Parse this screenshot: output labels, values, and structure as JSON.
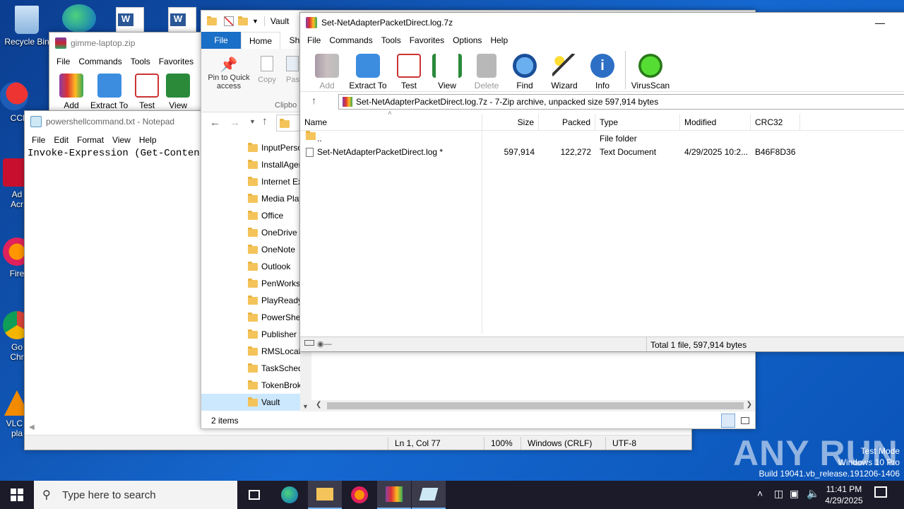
{
  "desktop": {
    "icons": [
      {
        "label": "Recycle Bin"
      },
      {
        "label": "CCle"
      },
      {
        "label": "Ad\nAcr"
      },
      {
        "label": "Fire"
      },
      {
        "label": "Go\nChr"
      },
      {
        "label": "VLC r\npla"
      }
    ],
    "watermark": "ANY RUN",
    "test_mode": {
      "line1": "Test Mode",
      "line2": "Windows 10 Pro",
      "line3": "Build 19041.vb_release.191206-1406"
    }
  },
  "zip_window": {
    "title": "gimme-laptop.zip",
    "menu": [
      "File",
      "Commands",
      "Tools",
      "Favorites"
    ],
    "toolbar": [
      "Add",
      "Extract To",
      "Test",
      "View"
    ]
  },
  "notepad": {
    "title": "powershellcommand.txt - Notepad",
    "menu": [
      "File",
      "Edit",
      "Format",
      "View",
      "Help"
    ],
    "content": "Invoke-Expression (Get-Content",
    "status": {
      "position": "Ln 1, Col 77",
      "zoom": "100%",
      "eol": "Windows (CRLF)",
      "encoding": "UTF-8"
    }
  },
  "explorer": {
    "title": "Vault",
    "tabs": {
      "file": "File",
      "home": "Home",
      "share": "Sh"
    },
    "ribbon": {
      "pin": "Pin to Quick access",
      "copy": "Copy",
      "paste": "Pas",
      "group": "Clipbo"
    },
    "folders": [
      "InputPerso",
      "InstallAger",
      "Internet Ex",
      "Media Play",
      "Office",
      "OneDrive",
      "OneNote",
      "Outlook",
      "PenWorks",
      "PlayReady",
      "PowerShel",
      "Publisher",
      "RMSLocalS",
      "TaskSched",
      "TokenBrok",
      "Vault"
    ],
    "selected_folder": "Vault",
    "item_count": "2 items"
  },
  "sevenzip": {
    "title": "Set-NetAdapterPacketDirect.log.7z",
    "menu": [
      "File",
      "Commands",
      "Tools",
      "Favorites",
      "Options",
      "Help"
    ],
    "toolbar": {
      "add": "Add",
      "extract": "Extract To",
      "test": "Test",
      "view": "View",
      "delete": "Delete",
      "find": "Find",
      "wizard": "Wizard",
      "info": "Info",
      "virusscan": "VirusScan"
    },
    "path": "Set-NetAdapterPacketDirect.log.7z - 7-Zip archive, unpacked size 597,914 bytes",
    "columns": {
      "name": "Name",
      "size": "Size",
      "packed": "Packed",
      "type": "Type",
      "modified": "Modified",
      "crc": "CRC32"
    },
    "rows": [
      {
        "name": "..",
        "size": "",
        "packed": "",
        "type": "File folder",
        "modified": "",
        "crc": ""
      },
      {
        "name": "Set-NetAdapterPacketDirect.log *",
        "size": "597,914",
        "packed": "122,272",
        "type": "Text Document",
        "modified": "4/29/2025 10:2...",
        "crc": "B46F8D36"
      }
    ],
    "status": "Total 1 file, 597,914 bytes"
  },
  "taskbar": {
    "search_placeholder": "Type here to search",
    "time": "11:41 PM",
    "date": "4/29/2025"
  },
  "colors": {
    "accent": "#0078d7",
    "taskbar": "#1b1b2a",
    "desktop": "#1568d0"
  }
}
